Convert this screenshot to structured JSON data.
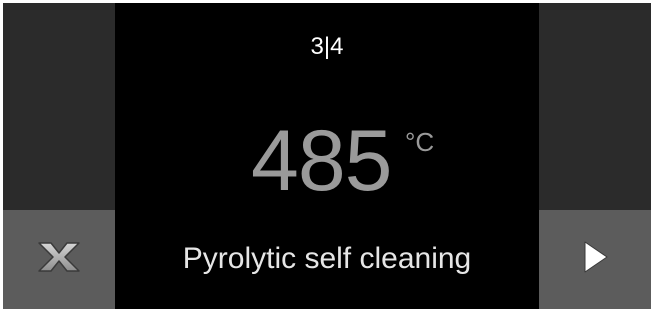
{
  "display": {
    "step": "3|4",
    "temperature": "485",
    "unit": "°C",
    "program": "Pyrolytic self cleaning"
  },
  "buttons": {
    "cancel_icon": "close-icon",
    "next_icon": "play-arrow-icon"
  },
  "colors": {
    "background": "#000000",
    "side_panel": "#2b2b2b",
    "button": "#5c5c5c",
    "temperature_text": "#9a9a9a",
    "label_text": "#e6e6e6"
  }
}
